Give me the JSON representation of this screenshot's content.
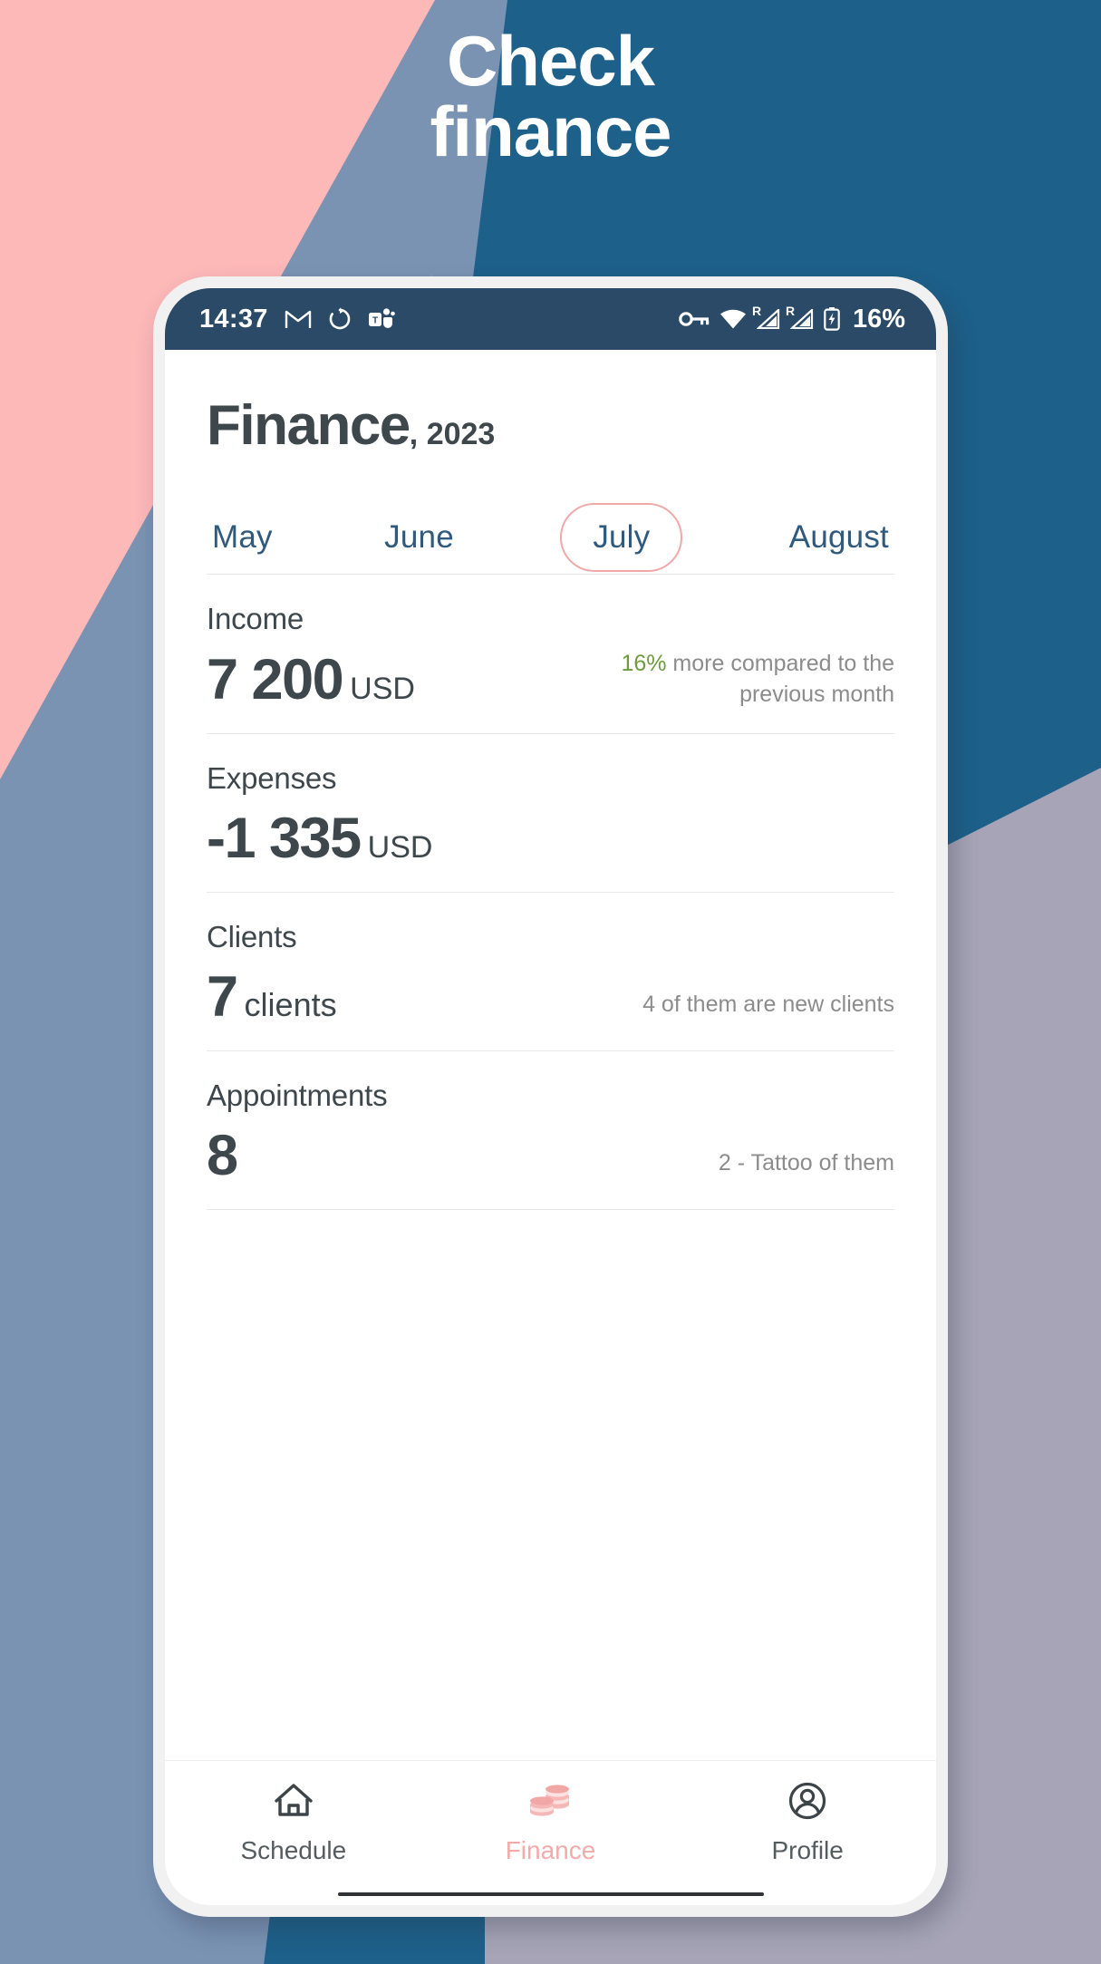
{
  "promo": {
    "headline_line1": "Check",
    "headline_line2": "finance",
    "bg_blue": "#1d6089",
    "bg_pink": "#fdb8b8",
    "bg_bluegrey": "#7a93b3",
    "bg_purplegrey": "#a6a4b6"
  },
  "status_bar": {
    "time": "14:37",
    "battery_percent": "16%",
    "left_icons": [
      "gmail-icon",
      "sync-icon",
      "teams-icon"
    ],
    "right_icons": [
      "vpn-key-icon",
      "wifi-icon",
      "signal-roaming-icon-1",
      "signal-roaming-icon-2",
      "battery-charging-icon"
    ],
    "roaming_label": "R",
    "background": "#2a4a67"
  },
  "header": {
    "title": "Finance",
    "year": ", 2023"
  },
  "month_tabs": {
    "items": [
      {
        "label": "May",
        "active": false
      },
      {
        "label": "June",
        "active": false
      },
      {
        "label": "July",
        "active": true
      },
      {
        "label": "August",
        "active": false
      }
    ],
    "active_border_color": "#f0a8a8",
    "text_color": "#2f5a7d"
  },
  "stats": [
    {
      "label": "Income",
      "value": "7 200",
      "unit": "USD",
      "note_highlight": "16%",
      "note_rest": " more compared to the previous month",
      "highlight_color": "#6d9b3e"
    },
    {
      "label": "Expenses",
      "value": "-1 335",
      "unit": "USD",
      "note_highlight": "",
      "note_rest": ""
    },
    {
      "label": "Clients",
      "value": "7",
      "unit": "clients",
      "note_highlight": "",
      "note_rest": "4 of them are new clients"
    },
    {
      "label": "Appointments",
      "value": "8",
      "unit": "",
      "note_highlight": "",
      "note_rest": "2 - Tattoo of them"
    }
  ],
  "bottom_nav": {
    "items": [
      {
        "label": "Schedule",
        "icon": "home-icon",
        "active": false
      },
      {
        "label": "Finance",
        "icon": "coins-icon",
        "active": true
      },
      {
        "label": "Profile",
        "icon": "person-circle-icon",
        "active": false
      }
    ],
    "active_color": "#f3aaaa",
    "inactive_color": "#555c60"
  }
}
